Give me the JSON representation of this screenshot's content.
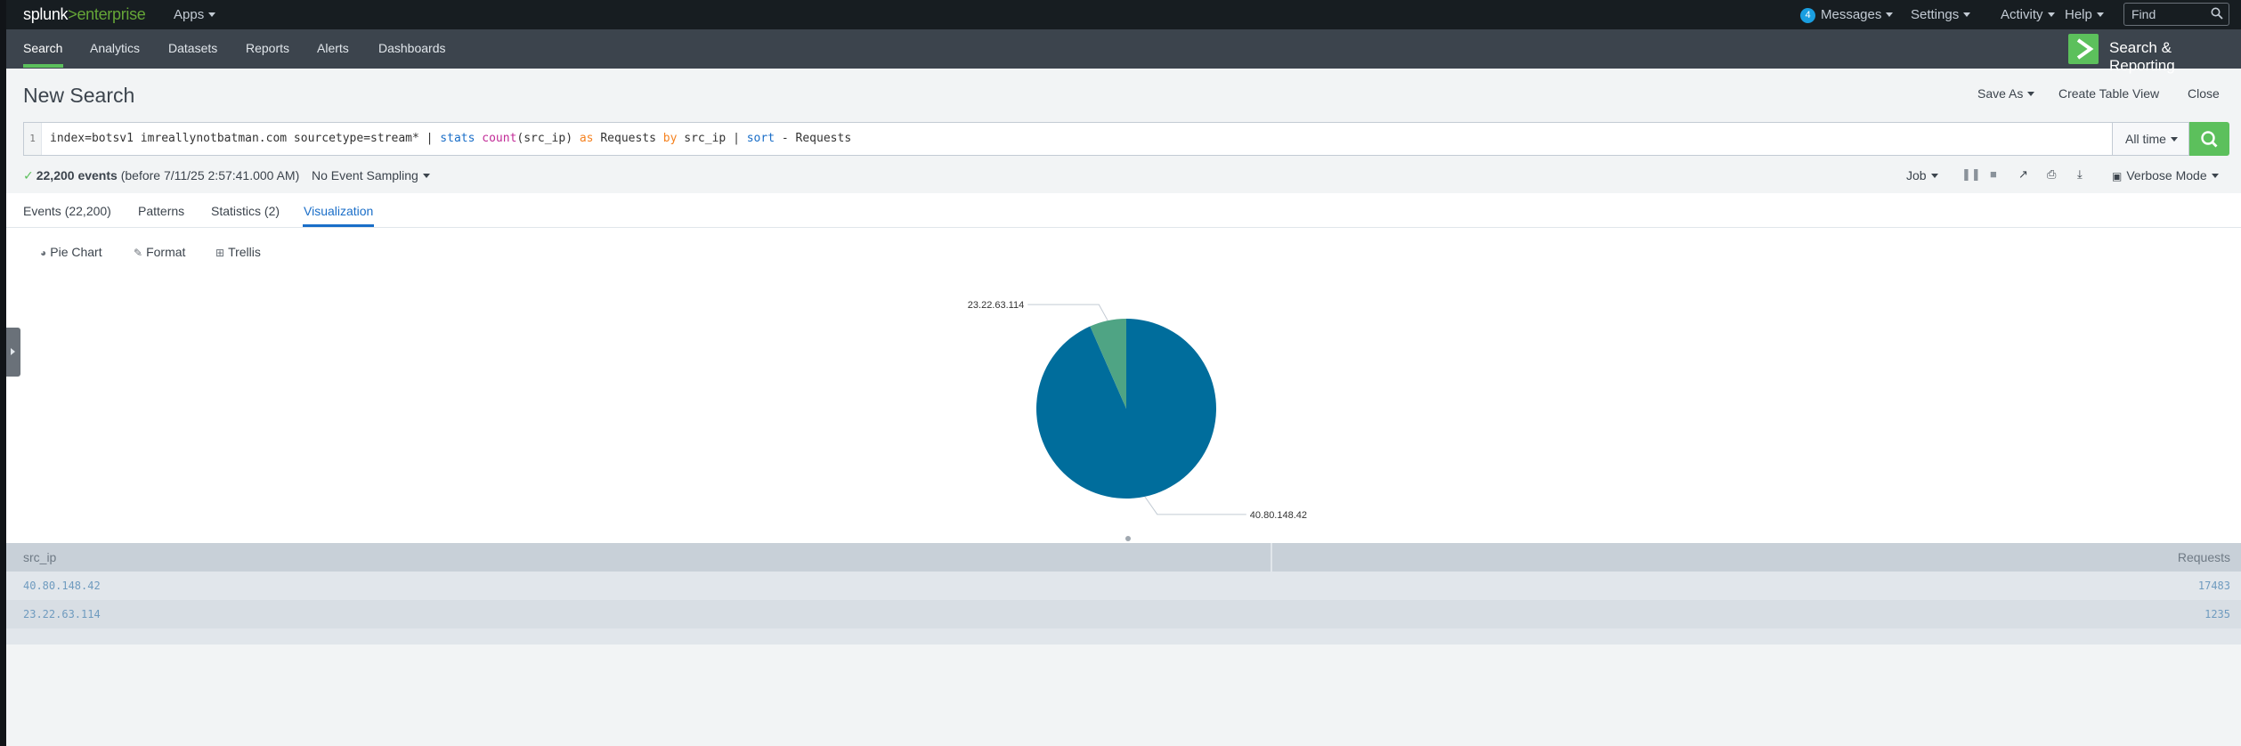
{
  "topbar": {
    "logo_left": "splunk",
    "logo_chevron": ">",
    "logo_right": "enterprise",
    "apps_label": "Apps",
    "messages_count": "4",
    "messages_label": "Messages",
    "settings_label": "Settings",
    "activity_label": "Activity",
    "help_label": "Help",
    "find_placeholder": "Find"
  },
  "nav": {
    "items": [
      {
        "label": "Search",
        "active": true
      },
      {
        "label": "Analytics"
      },
      {
        "label": "Datasets"
      },
      {
        "label": "Reports"
      },
      {
        "label": "Alerts"
      },
      {
        "label": "Dashboards"
      }
    ],
    "app_title": "Search & Reporting"
  },
  "header": {
    "title": "New Search",
    "save_as": "Save As",
    "create_table_view": "Create Table View",
    "close": "Close"
  },
  "search": {
    "line_number": "1",
    "query_parts": {
      "p1": "index=botsv1 imreallynotbatman.com sourcetype=stream* | ",
      "p2": "stats",
      "p3": " ",
      "p4": "count",
      "p5": "(src_ip) ",
      "p6": "as",
      "p7": " Requests ",
      "p8": "by",
      "p9": " src_ip | ",
      "p10": "sort",
      "p11": " - Requests"
    },
    "time_range": "All time"
  },
  "status": {
    "events": "22,200 events",
    "before": "(before 7/11/25 2:57:41.000 AM)",
    "sampling": "No Event Sampling",
    "job": "Job",
    "mode": "Verbose Mode"
  },
  "tabs": [
    {
      "label": "Events (22,200)"
    },
    {
      "label": "Patterns"
    },
    {
      "label": "Statistics (2)"
    },
    {
      "label": "Visualization",
      "active": true
    }
  ],
  "viz_controls": {
    "chart_type": "Pie Chart",
    "format": "Format",
    "trellis": "Trellis"
  },
  "chart_data": {
    "type": "pie",
    "categories": [
      "40.80.148.42",
      "23.22.63.114"
    ],
    "values": [
      17483,
      1235
    ],
    "colors": [
      "#006d9c",
      "#4fa484"
    ]
  },
  "table": {
    "headers": [
      "src_ip",
      "Requests"
    ],
    "rows": [
      {
        "src_ip": "40.80.148.42",
        "requests": "17483"
      },
      {
        "src_ip": "23.22.63.114",
        "requests": "1235"
      }
    ]
  },
  "colors": {
    "topbar_bg": "#171d21",
    "navbar_bg": "#3c444d",
    "accent_green": "#5cc05c",
    "link_blue": "#1a6ec8"
  }
}
